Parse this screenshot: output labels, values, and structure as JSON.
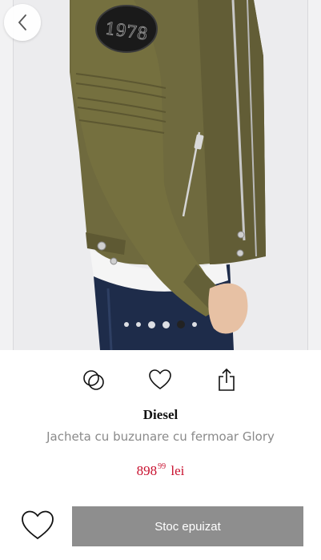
{
  "gallery": {
    "slide_count": 6,
    "active_index": 4,
    "patch_text": "1978",
    "icon_back": "chevron-left-icon"
  },
  "actions": {
    "compare_icon": "overlapping-circles-icon",
    "wishlist_icon": "heart-icon",
    "share_icon": "share-icon"
  },
  "product": {
    "brand": "Diesel",
    "name": "Jacheta cu buzunare cu fermoar Glory",
    "price_main": "898",
    "price_cents": "99",
    "currency": "lei"
  },
  "footer": {
    "wishlist_icon": "heart-icon",
    "stock_button_label": "Stoc epuizat"
  },
  "colors": {
    "price": "#c8102e",
    "stock_button": "#8e8e8e",
    "jacket": "#6f6a3e"
  }
}
